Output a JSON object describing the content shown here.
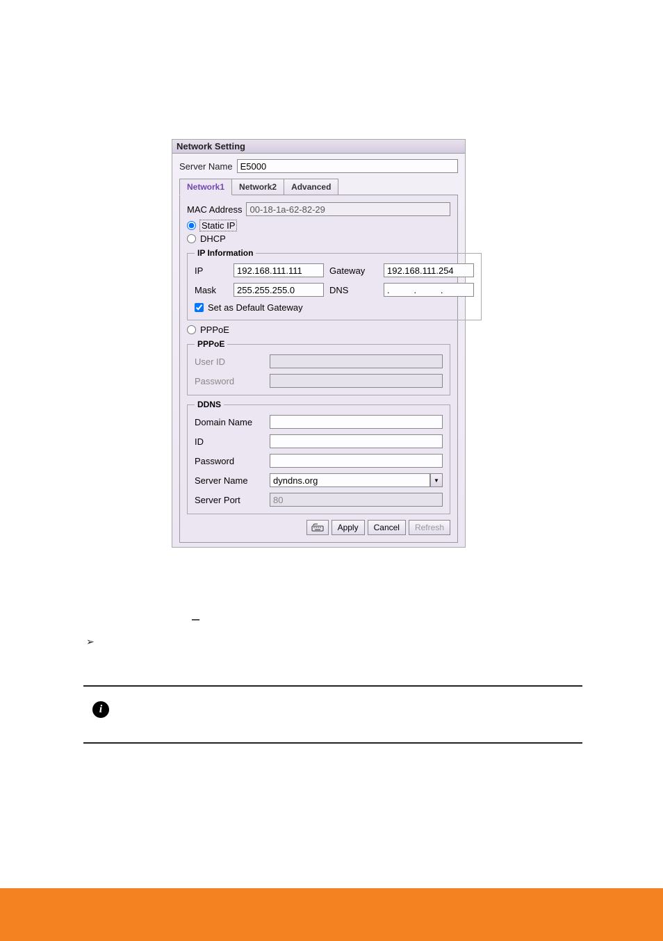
{
  "window": {
    "title": "Network Setting",
    "server_name_label": "Server Name",
    "server_name_value": "E5000",
    "tabs": {
      "network1": "Network1",
      "network2": "Network2",
      "advanced": "Advanced"
    },
    "mac_label": "MAC Address",
    "mac_value": "00-18-1a-62-82-29",
    "radio_static_ip": "Static IP",
    "radio_dhcp": "DHCP",
    "radio_pppoe": "PPPoE",
    "ip_info": {
      "legend": "IP Information",
      "ip_label": "IP",
      "ip_value": "192.168.111.111",
      "gateway_label": "Gateway",
      "gateway_value": "192.168.111.254",
      "mask_label": "Mask",
      "mask_value": "255.255.255.0",
      "dns_label": "DNS",
      "dns_value": ".   .   .",
      "default_gateway_label": "Set as Default Gateway"
    },
    "pppoe": {
      "legend": "PPPoE",
      "user_id_label": "User ID",
      "password_label": "Password"
    },
    "ddns": {
      "legend": "DDNS",
      "domain_name_label": "Domain Name",
      "id_label": "ID",
      "password_label": "Password",
      "server_name_label": "Server Name",
      "server_name_value": "dyndns.org",
      "server_port_label": "Server Port",
      "server_port_value": "80"
    },
    "buttons": {
      "apply": "Apply",
      "cancel": "Cancel",
      "refresh": "Refresh"
    }
  }
}
